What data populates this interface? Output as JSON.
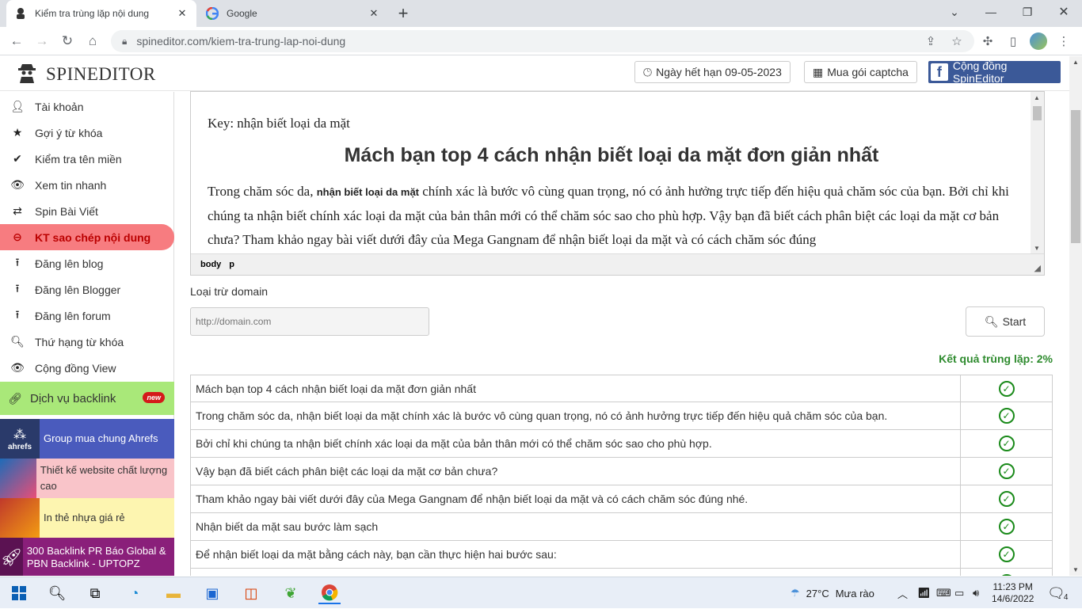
{
  "browser": {
    "tabs": [
      {
        "title": "Kiểm tra trùng lặp nội dung",
        "active": true
      },
      {
        "title": "Google",
        "active": false
      }
    ],
    "url": "spineditor.com/kiem-tra-trung-lap-noi-dung"
  },
  "header": {
    "brand": "SPINEDITOR",
    "expiry_label": "Ngày hết hạn 09-05-2023",
    "captcha_label": "Mua gói captcha",
    "community_label": "Cộng đồng SpinEditor"
  },
  "sidebar": {
    "items": [
      {
        "label": "Tài khoản",
        "icon": "user-icon"
      },
      {
        "label": "Gợi ý từ khóa",
        "icon": "star-icon"
      },
      {
        "label": "Kiểm tra tên miền",
        "icon": "check-icon"
      },
      {
        "label": "Xem tin nhanh",
        "icon": "eye-icon"
      },
      {
        "label": "Spin Bài Viết",
        "icon": "shuffle-icon"
      },
      {
        "label": "KT sao chép nội dung",
        "icon": "minus-circle-icon",
        "active": true
      },
      {
        "label": "Đăng lên blog",
        "icon": "upload-icon"
      },
      {
        "label": "Đăng lên Blogger",
        "icon": "upload-icon"
      },
      {
        "label": "Đăng lên forum",
        "icon": "upload-icon"
      },
      {
        "label": "Thứ hạng từ khóa",
        "icon": "search-icon"
      },
      {
        "label": "Cộng đồng View",
        "icon": "eye-icon"
      }
    ],
    "backlink": {
      "label": "Dịch vụ backlink",
      "badge": "new"
    },
    "ads": [
      {
        "text": "Group mua chung Ahrefs",
        "thumb_label": "ahrefs",
        "bg": "#4a5bbd",
        "color": "#ffffff"
      },
      {
        "text": "Thiết kế website chất lượng cao",
        "bg": "#f9c4c9",
        "color": "#333333"
      },
      {
        "text": "In thẻ nhựa giá rẻ",
        "bg": "#fdf5b0",
        "color": "#333333"
      },
      {
        "text": "300 Backlink PR Báo Global & PBN Backlink - UPTOPZ",
        "bg": "#8a1f7a",
        "color": "#ffffff"
      }
    ]
  },
  "editor": {
    "key_line": "Key: nhận biết loại da mặt",
    "heading": "Mách bạn top 4 cách nhận biết loại da mặt đơn giản nhất",
    "para_start": "Trong chăm sóc da, ",
    "para_bold": "nhận biết loại da mặt",
    "para_rest": " chính xác là bước vô cùng quan trọng, nó có ảnh hưởng trực tiếp đến hiệu quả chăm sóc của bạn. Bởi chỉ khi chúng ta nhận biết chính xác loại da mặt của bản thân mới có thể chăm sóc sao cho phù hợp. Vậy bạn đã biết cách phân biệt các loại da mặt cơ bản chưa? Tham khảo ngay bài viết dưới đây của Mega Gangnam để nhận biết loại da mặt và có cách chăm sóc đúng",
    "path_body": "body",
    "path_p": "p"
  },
  "exclude": {
    "label": "Loại trừ domain",
    "placeholder": "http://domain.com",
    "start_label": "Start"
  },
  "result": {
    "summary": "Kết quả trùng lặp: 2%",
    "rows": [
      "Mách bạn top 4 cách nhận biết loại da mặt đơn giản nhất",
      "Trong chăm sóc da, nhận biết loại da mặt chính xác là bước vô cùng quan trọng, nó có ảnh hưởng trực tiếp đến hiệu quả chăm sóc của bạn.",
      "Bởi chỉ khi chúng ta nhận biết chính xác loại da mặt của bản thân mới có thể chăm sóc sao cho phù hợp.",
      "Vậy bạn đã biết cách phân biệt các loại da mặt cơ bản chưa?",
      "Tham khảo ngay bài viết dưới đây của Mega Gangnam để nhận biết loại da mặt và có cách chăm sóc đúng nhé.",
      "Nhận biết da mặt sau bước làm sạch",
      "Để nhận biết loại da mặt bằng cách này, bạn cần thực hiện hai bước sau:"
    ]
  },
  "taskbar": {
    "weather": "27°C",
    "weather_desc": "Mưa rào",
    "time": "11:23 PM",
    "date": "14/6/2022",
    "notif_count": "4"
  }
}
